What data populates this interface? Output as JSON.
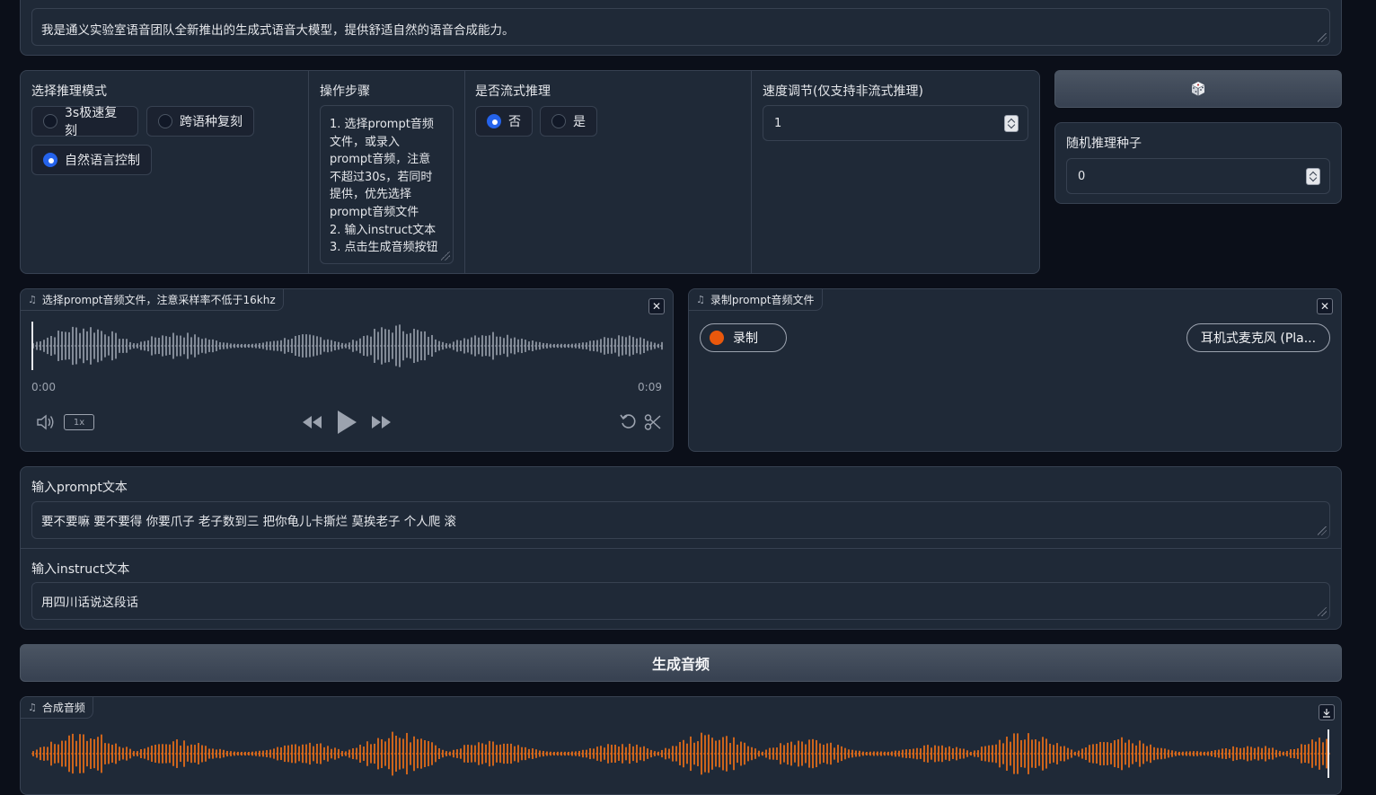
{
  "tts_text": {
    "value": "我是通义实验室语音团队全新推出的生成式语音大模型，提供舒适自然的语音合成能力。"
  },
  "mode": {
    "label": "选择推理模式",
    "options": [
      "3s极速复刻",
      "跨语种复刻",
      "自然语言控制"
    ],
    "selected": "自然语言控制"
  },
  "steps": {
    "label": "操作步骤",
    "lines": [
      "1. 选择prompt音频",
      "文件，或录入",
      "prompt音频，注意",
      "不超过30s，若同时",
      "提供，优先选择",
      "prompt音频文件",
      "2. 输入instruct文本",
      "3. 点击生成音频按钮"
    ]
  },
  "stream": {
    "label": "是否流式推理",
    "options": [
      "否",
      "是"
    ],
    "selected": "否"
  },
  "speed": {
    "label": "速度调节(仅支持非流式推理)",
    "value": "1"
  },
  "seed": {
    "dice_icon": "dice-icon",
    "label": "随机推理种子",
    "value": "0"
  },
  "prompt_audio": {
    "label": "选择prompt音频文件，注意采样率不低于16khz",
    "time_start": "0:00",
    "time_end": "0:09",
    "playback_rate": "1x",
    "wave_color": "#9ca3af"
  },
  "record": {
    "label": "录制prompt音频文件",
    "record_label": "录制",
    "mic_label": "耳机式麦克风 (Pla..."
  },
  "prompt_text": {
    "label": "输入prompt文本",
    "value": "要不要嘛 要不要得 你要爪子 老子数到三 把你龟儿卡撕烂 莫挨老子 个人爬 滚"
  },
  "instruct_text": {
    "label": "输入instruct文本",
    "value": "用四川话说这段话"
  },
  "generate": {
    "label": "生成音频"
  },
  "output_audio": {
    "label": "合成音频",
    "wave_color": "#f97316"
  },
  "colors": {
    "accent": "#2563eb",
    "record": "#ea580c",
    "bg": "#0b0f19",
    "panel": "#1f2937"
  }
}
